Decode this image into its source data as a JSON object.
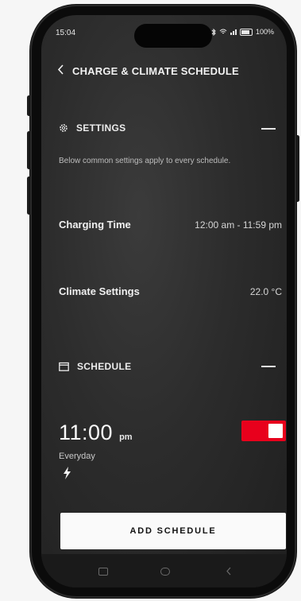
{
  "status": {
    "time": "15:04",
    "battery": "100%"
  },
  "header": {
    "back_icon": "chevron-left-icon",
    "title": "CHARGE & CLIMATE SCHEDULE"
  },
  "settings": {
    "icon": "gear-icon",
    "label": "SETTINGS",
    "description": "Below common settings apply to every schedule.",
    "charging_time": {
      "label": "Charging Time",
      "value": "12:00 am - 11:59 pm"
    },
    "climate": {
      "label": "Climate Settings",
      "value": "22.0 °C"
    }
  },
  "schedule": {
    "icon": "calendar-icon",
    "label": "SCHEDULE",
    "item": {
      "time": "11:00",
      "ampm": "pm",
      "frequency": "Everyday",
      "type_icon": "bolt-icon",
      "enabled": true
    }
  },
  "add_button": {
    "label": "ADD SCHEDULE"
  },
  "colors": {
    "accent": "#e8001c",
    "background": "#2c2c2c",
    "text": "#ffffff"
  }
}
